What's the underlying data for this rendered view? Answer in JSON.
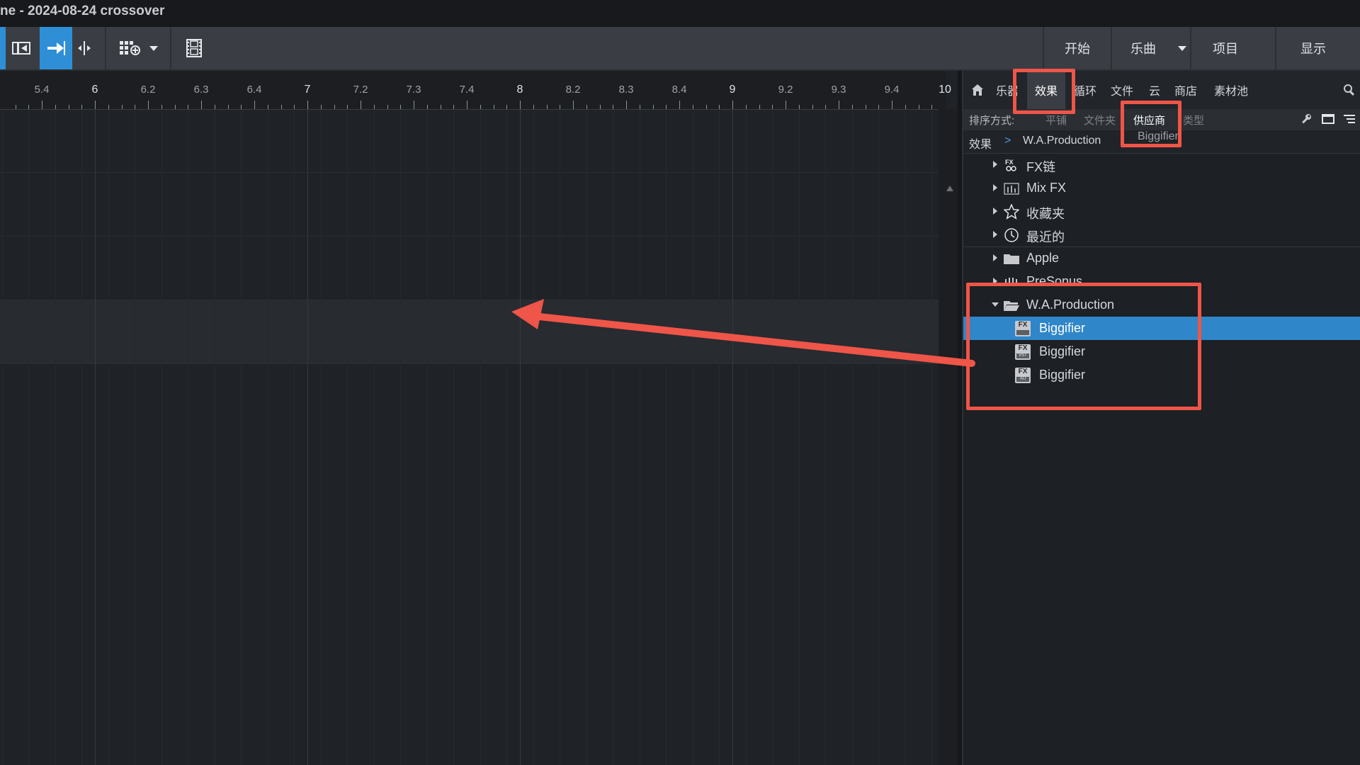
{
  "window": {
    "title": "ne - 2024-08-24 crossover"
  },
  "toolbar": {
    "nav": [
      {
        "label": "开始"
      },
      {
        "label": "乐曲"
      },
      {
        "label": "项目"
      },
      {
        "label": "显示"
      }
    ]
  },
  "ruler": {
    "labels": [
      "5.4",
      "6",
      "6.2",
      "6.3",
      "6.4",
      "7",
      "7.2",
      "7.3",
      "7.4",
      "8",
      "8.2",
      "8.3",
      "8.4",
      "9",
      "9.2",
      "9.3",
      "9.4",
      "10"
    ]
  },
  "browser": {
    "tabs": [
      "乐器",
      "效果",
      "循环",
      "文件",
      "云",
      "商店",
      "素材池"
    ],
    "active_tab": "效果",
    "sort": {
      "label": "排序方式:",
      "options": [
        "平铺",
        "文件夹",
        "供应商",
        "类型"
      ],
      "active": "供应商"
    },
    "breadcrumb": {
      "root": "效果",
      "separator": ">",
      "vendor": "W.A.Production",
      "item": "Biggifier"
    },
    "tree": [
      {
        "label": "FX链",
        "icon": "fx-chain-icon"
      },
      {
        "label": "Mix FX",
        "icon": "mixer-icon"
      },
      {
        "label": "收藏夹",
        "icon": "star-icon"
      },
      {
        "label": "最近的",
        "icon": "clock-icon"
      },
      {
        "label": "Apple",
        "icon": "folder-icon"
      },
      {
        "label": "PreSonus",
        "icon": "presonus-icon"
      },
      {
        "label": "W.A.Production",
        "icon": "folder-open-icon"
      }
    ],
    "plugins": [
      {
        "label": "Biggifier",
        "badge": "FX",
        "format": "",
        "selected": true
      },
      {
        "label": "Biggifier",
        "badge": "FX",
        "format": "VST",
        "selected": false
      },
      {
        "label": "Biggifier",
        "badge": "FX",
        "format": "AU",
        "selected": false
      }
    ]
  },
  "colors": {
    "accent": "#2e8fd6",
    "selection": "#2f86c8",
    "annotation": "#ef5548"
  }
}
